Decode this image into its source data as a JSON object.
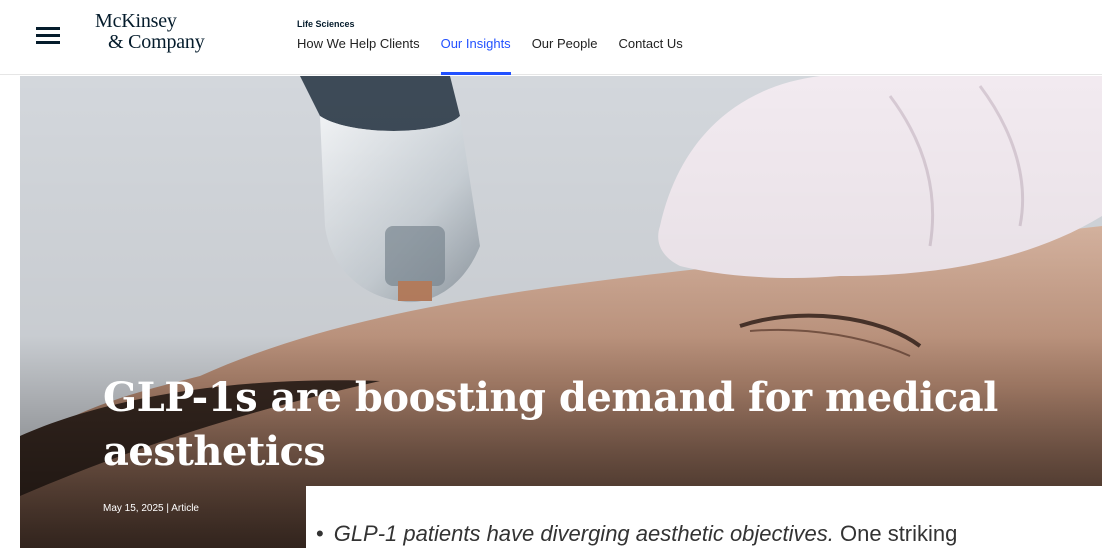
{
  "header": {
    "logo_line1": "McKinsey",
    "logo_line2": "& Company",
    "section_label": "Life Sciences",
    "nav": [
      {
        "label": "How We Help Clients",
        "active": false
      },
      {
        "label": "Our Insights",
        "active": true
      },
      {
        "label": "Our People",
        "active": false
      },
      {
        "label": "Contact Us",
        "active": false
      }
    ]
  },
  "hero": {
    "title": "GLP-1s are boosting demand for medical aesthetics",
    "meta": "May 15, 2025 | Article"
  },
  "content": {
    "bullet_italic": "GLP-1 patients have diverging aesthetic objectives.",
    "bullet_text": " One striking"
  },
  "colors": {
    "brand_dark": "#051c2c",
    "accent": "#2251ff"
  },
  "icons": [
    "hamburger-menu-icon"
  ]
}
